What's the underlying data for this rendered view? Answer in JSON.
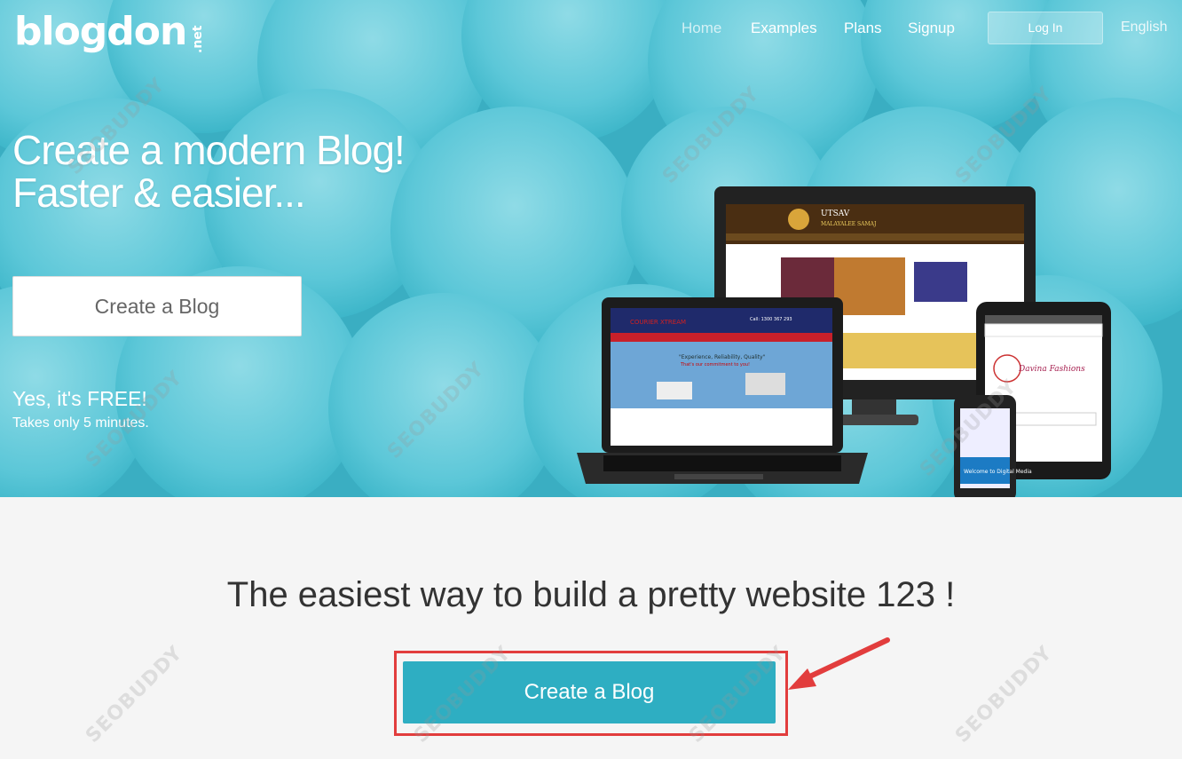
{
  "brand": {
    "name": "blogdon",
    "tld": ".net"
  },
  "nav": {
    "items": [
      {
        "label": "Home",
        "active": true
      },
      {
        "label": "Examples"
      },
      {
        "label": "Plans"
      },
      {
        "label": "Signup"
      }
    ],
    "login_label": "Log In",
    "language": "English"
  },
  "hero": {
    "headline_line1": "Create a modern Blog!",
    "headline_line2": "Faster & easier...",
    "button_label": "Create a Blog",
    "free_text": "Yes, it's FREE!",
    "takes_text": "Takes only 5 minutes."
  },
  "main": {
    "tagline": "The easiest way to build a pretty website 123 !",
    "cta_label": "Create a Blog"
  },
  "devices_screens": {
    "monitor_site": "UTSAV",
    "monitor_subtitle": "MALAYALEE SAMAJ",
    "laptop_site": "COURIER XTREAM",
    "laptop_phone": "Call: 1300 367 293",
    "laptop_slogan": "\"Experience, Reliability, Quality\"",
    "laptop_slogan2": "That's our commitment to you!",
    "tablet_site": "Davina Fashions",
    "phone_text": "Welcome to Digital Media"
  },
  "watermark": "SEOBUDDY",
  "colors": {
    "hero_bg": "#3db6c9",
    "cta": "#2eaec2",
    "highlight": "#e23d3d"
  }
}
